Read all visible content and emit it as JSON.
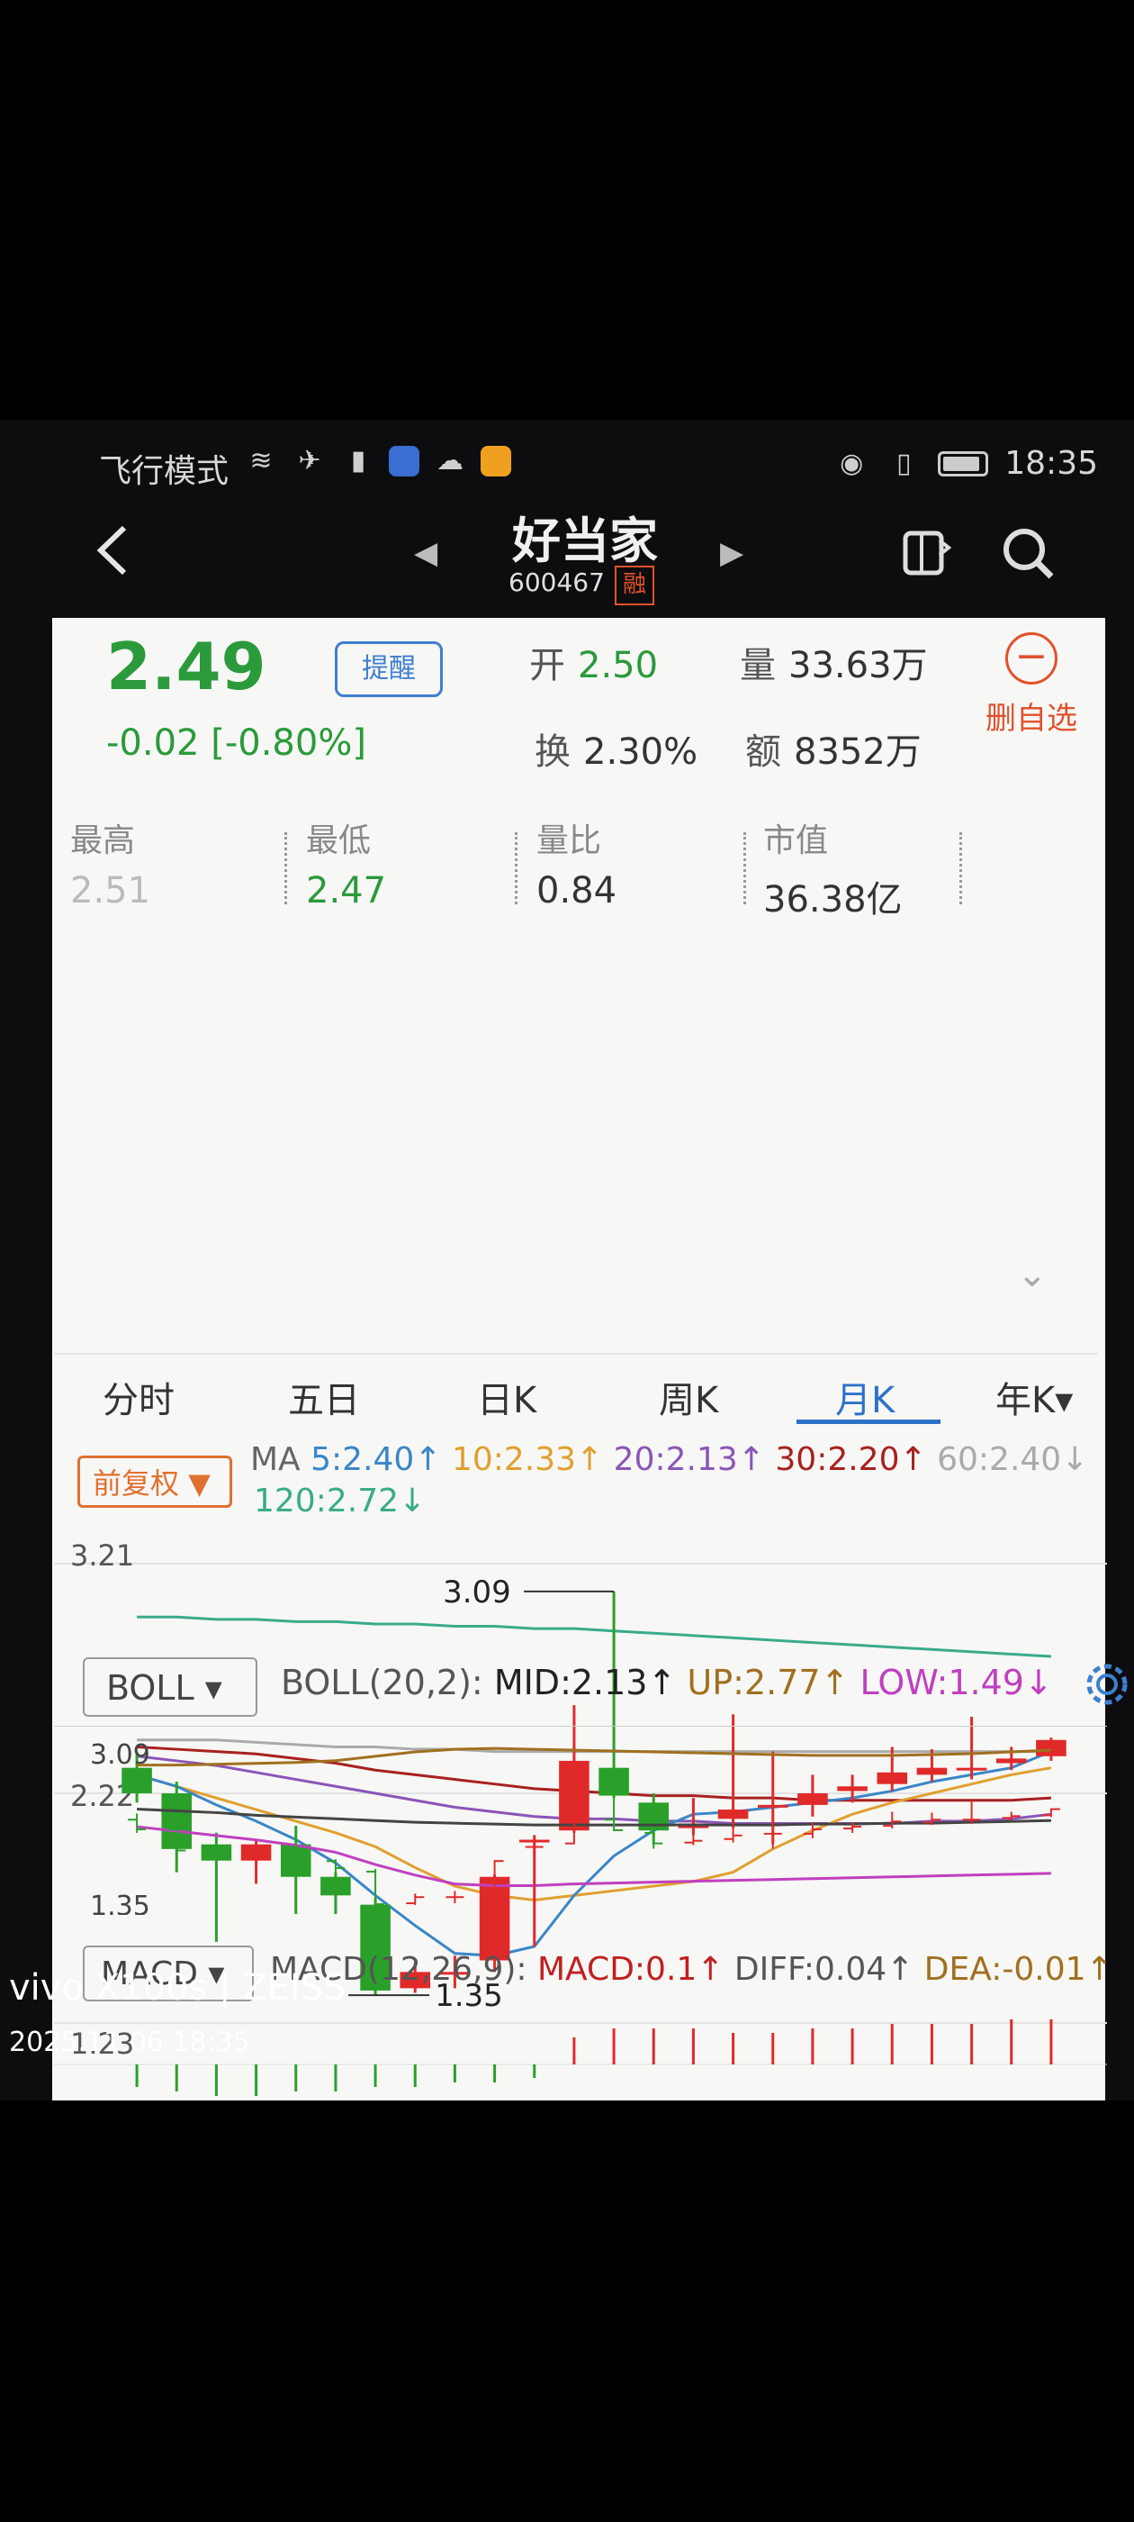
{
  "status_bar": {
    "mode": "飞行模式",
    "time": "18:35"
  },
  "nav": {
    "title": "好当家",
    "code": "600467",
    "badge": "融"
  },
  "quote": {
    "price": "2.49",
    "change": "-0.02 [-0.80%]",
    "remind_label": "提醒",
    "open_label": "开",
    "open_value": "2.50",
    "volume_label": "量",
    "volume_value": "33.63万",
    "turnover_label": "换",
    "turnover_value": "2.30%",
    "amount_label": "额",
    "amount_value": "8352万",
    "del_fav_label": "删自选"
  },
  "stats": [
    {
      "label": "最高",
      "value": "2.51"
    },
    {
      "label": "最低",
      "value": "2.47"
    },
    {
      "label": "量比",
      "value": "0.84"
    },
    {
      "label": "市值",
      "value": "36.38亿"
    }
  ],
  "tabs": [
    "分时",
    "五日",
    "日K",
    "周K",
    "月K",
    "年K▾"
  ],
  "active_tab": "月K",
  "adjust_label": "前复权",
  "ma": {
    "prefix": "MA",
    "ma5": "5:2.40↑",
    "ma10": "10:2.33↑",
    "ma20": "20:2.13↑",
    "ma30": "30:2.20↑",
    "ma60": "60:2.40↓",
    "ma120": "120:2.72↓"
  },
  "colors": {
    "up": "#e02a2a",
    "down": "#2aa02a",
    "ma5": "#3a86c8",
    "ma10": "#e0a030",
    "ma20": "#8a55b8",
    "ma30": "#a82020",
    "ma60": "#aaaaaa",
    "ma120": "#3aab8a",
    "boll_up": "#a07020",
    "boll_mid": "#444444",
    "boll_low": "#c040c0"
  },
  "main_chart": {
    "y_top_label": "3.21",
    "y_mid_label": "2.22",
    "y_bottom_label": "1.23",
    "high_label": "3.09",
    "low_label": "1.35"
  },
  "boll": {
    "button": "BOLL",
    "params": "BOLL(20,2):",
    "mid": "MID:2.13↑",
    "up": "UP:2.77↑",
    "low": "LOW:1.49↓",
    "y_top_label": "3.09",
    "y_bottom_label": "1.35"
  },
  "macd": {
    "button": "MACD",
    "params": "MACD(12,26,9):",
    "macd": "MACD:0.1↑",
    "diff": "DIFF:0.04↑",
    "dea": "DEA:-0.01↑"
  },
  "watermark": {
    "brand": "vivo X100s | ZEISS",
    "datetime": "2025.11.06 18:35"
  },
  "chart_data": {
    "type": "candlestick",
    "y_range": [
      1.23,
      3.21
    ],
    "candles": [
      {
        "o": 2.33,
        "c": 2.22,
        "h": 2.4,
        "l": 2.18
      },
      {
        "o": 2.22,
        "c": 1.98,
        "h": 2.27,
        "l": 1.88
      },
      {
        "o": 2.0,
        "c": 1.93,
        "h": 2.05,
        "l": 1.58
      },
      {
        "o": 1.93,
        "c": 2.0,
        "h": 2.02,
        "l": 1.83
      },
      {
        "o": 2.0,
        "c": 1.86,
        "h": 2.08,
        "l": 1.7
      },
      {
        "o": 1.86,
        "c": 1.78,
        "h": 1.88,
        "l": 1.7
      },
      {
        "o": 1.74,
        "c": 1.37,
        "h": 1.77,
        "l": 1.35
      },
      {
        "o": 1.38,
        "c": 1.45,
        "h": 1.49,
        "l": 1.36
      },
      {
        "o": 1.45,
        "c": 1.45,
        "h": 1.52,
        "l": 1.38
      },
      {
        "o": 1.5,
        "c": 1.86,
        "h": 1.87,
        "l": 1.45
      },
      {
        "o": 2.02,
        "c": 2.02,
        "h": 2.04,
        "l": 1.56
      },
      {
        "o": 2.06,
        "c": 2.36,
        "h": 2.6,
        "l": 2.05
      },
      {
        "o": 2.33,
        "c": 2.21,
        "h": 3.09,
        "l": 2.2
      },
      {
        "o": 2.18,
        "c": 2.06,
        "h": 2.22,
        "l": 2.0
      },
      {
        "o": 2.07,
        "c": 2.09,
        "h": 2.2,
        "l": 2.04
      },
      {
        "o": 2.11,
        "c": 2.15,
        "h": 2.56,
        "l": 2.07
      },
      {
        "o": 2.17,
        "c": 2.17,
        "h": 2.4,
        "l": 2.0
      },
      {
        "o": 2.17,
        "c": 2.22,
        "h": 2.3,
        "l": 2.12
      },
      {
        "o": 2.23,
        "c": 2.25,
        "h": 2.3,
        "l": 2.18
      },
      {
        "o": 2.26,
        "c": 2.31,
        "h": 2.42,
        "l": 2.23
      },
      {
        "o": 2.3,
        "c": 2.33,
        "h": 2.41,
        "l": 2.27
      },
      {
        "o": 2.33,
        "c": 2.33,
        "h": 2.55,
        "l": 2.28
      },
      {
        "o": 2.35,
        "c": 2.37,
        "h": 2.42,
        "l": 2.32
      },
      {
        "o": 2.38,
        "c": 2.45,
        "h": 2.46,
        "l": 2.36
      }
    ],
    "ma5": [
      2.3,
      2.25,
      2.17,
      2.1,
      2.02,
      1.92,
      1.78,
      1.65,
      1.53,
      1.52,
      1.56,
      1.78,
      1.95,
      2.06,
      2.13,
      2.14,
      2.16,
      2.18,
      2.2,
      2.23,
      2.27,
      2.3,
      2.33,
      2.4
    ],
    "ma10": [
      2.3,
      2.25,
      2.2,
      2.15,
      2.1,
      2.05,
      1.99,
      1.9,
      1.82,
      1.78,
      1.76,
      1.78,
      1.8,
      1.82,
      1.84,
      1.88,
      1.98,
      2.06,
      2.13,
      2.18,
      2.22,
      2.26,
      2.3,
      2.33
    ],
    "ma20": [
      2.38,
      2.36,
      2.34,
      2.31,
      2.28,
      2.25,
      2.22,
      2.19,
      2.16,
      2.14,
      2.12,
      2.11,
      2.11,
      2.1,
      2.1,
      2.09,
      2.09,
      2.09,
      2.09,
      2.09,
      2.1,
      2.1,
      2.11,
      2.13
    ],
    "ma30": [
      2.42,
      2.41,
      2.4,
      2.39,
      2.37,
      2.35,
      2.32,
      2.3,
      2.28,
      2.26,
      2.24,
      2.23,
      2.22,
      2.21,
      2.21,
      2.2,
      2.2,
      2.19,
      2.19,
      2.19,
      2.19,
      2.19,
      2.19,
      2.2
    ],
    "ma60": [
      2.45,
      2.45,
      2.45,
      2.44,
      2.43,
      2.42,
      2.42,
      2.41,
      2.41,
      2.4,
      2.4,
      2.4,
      2.4,
      2.4,
      2.4,
      2.4,
      2.4,
      2.4,
      2.4,
      2.4,
      2.4,
      2.4,
      2.4,
      2.4
    ],
    "ma120": [
      2.98,
      2.98,
      2.97,
      2.97,
      2.96,
      2.96,
      2.95,
      2.95,
      2.94,
      2.94,
      2.93,
      2.93,
      2.92,
      2.91,
      2.9,
      2.89,
      2.88,
      2.87,
      2.86,
      2.85,
      2.84,
      2.83,
      2.82,
      2.81
    ],
    "boll_range": [
      1.35,
      3.09
    ],
    "boll_up": [
      2.95,
      2.95,
      2.96,
      2.97,
      2.98,
      3.0,
      3.05,
      3.1,
      3.13,
      3.14,
      3.13,
      3.12,
      3.11,
      3.1,
      3.09,
      3.08,
      3.07,
      3.06,
      3.06,
      3.06,
      3.07,
      3.08,
      3.1,
      3.12
    ],
    "boll_mid": [
      2.45,
      2.43,
      2.41,
      2.38,
      2.36,
      2.34,
      2.32,
      2.3,
      2.29,
      2.28,
      2.27,
      2.27,
      2.27,
      2.27,
      2.27,
      2.27,
      2.27,
      2.28,
      2.28,
      2.29,
      2.29,
      2.3,
      2.31,
      2.32
    ],
    "boll_low": [
      2.25,
      2.2,
      2.15,
      2.1,
      2.04,
      1.96,
      1.82,
      1.7,
      1.6,
      1.58,
      1.58,
      1.6,
      1.61,
      1.62,
      1.63,
      1.64,
      1.65,
      1.66,
      1.67,
      1.68,
      1.69,
      1.7,
      1.71,
      1.72
    ],
    "macd_bars": [
      -0.05,
      -0.06,
      -0.07,
      -0.07,
      -0.06,
      -0.06,
      -0.05,
      -0.05,
      -0.04,
      -0.04,
      -0.03,
      0.06,
      0.08,
      0.08,
      0.08,
      0.07,
      0.07,
      0.08,
      0.08,
      0.09,
      0.09,
      0.09,
      0.1,
      0.1
    ]
  }
}
